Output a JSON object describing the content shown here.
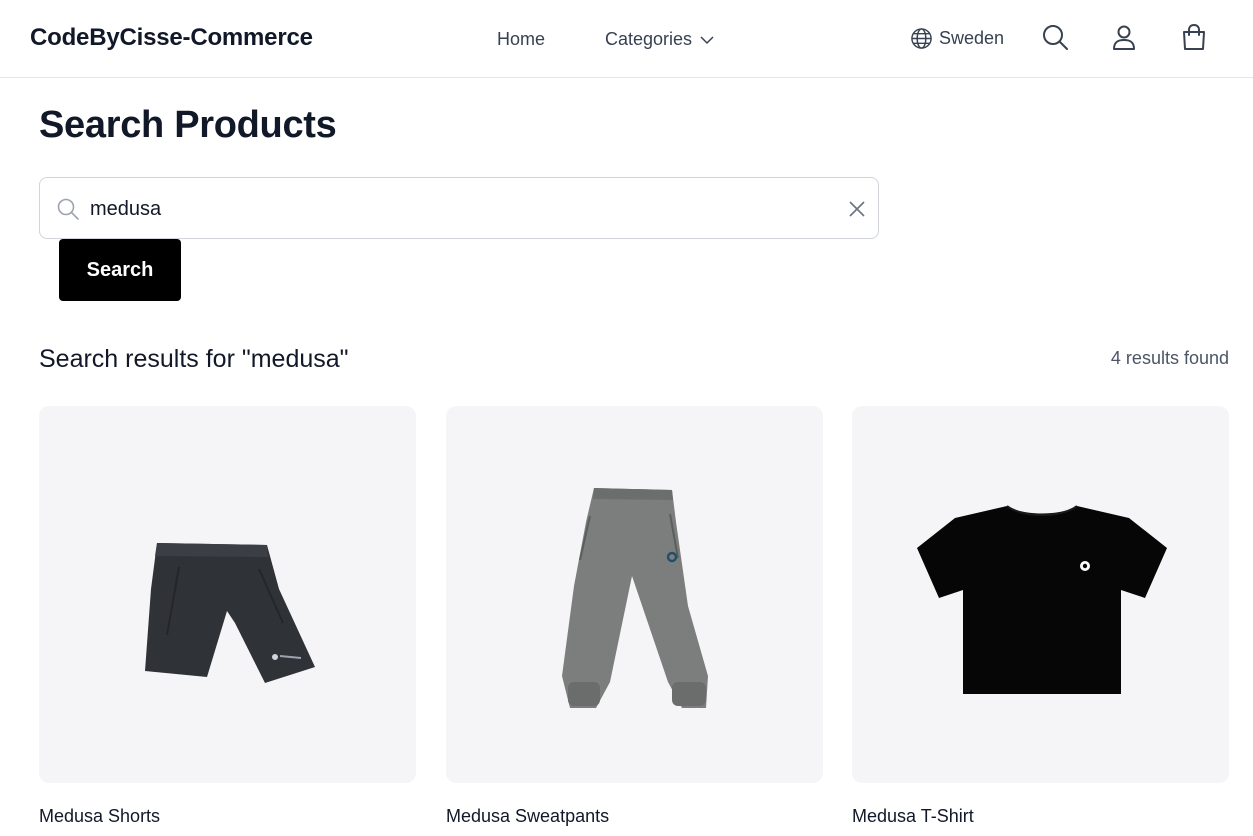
{
  "header": {
    "brand": "CodeByCisse-Commerce",
    "nav_home": "Home",
    "nav_categories": "Categories",
    "region": "Sweden",
    "icons": [
      "globe-icon",
      "search-icon",
      "user-icon",
      "cart-icon"
    ]
  },
  "page": {
    "title": "Search Products"
  },
  "search": {
    "value": "medusa",
    "button_label": "Search"
  },
  "results": {
    "heading": "Search results for \"medusa\"",
    "count": "4 results found",
    "products": [
      {
        "name": "Medusa Shorts"
      },
      {
        "name": "Medusa Sweatpants"
      },
      {
        "name": "Medusa T-Shirt"
      }
    ]
  },
  "colors": {
    "primary_button": "#000000",
    "card_background": "#f5f5f7",
    "border": "#d1d5db"
  }
}
